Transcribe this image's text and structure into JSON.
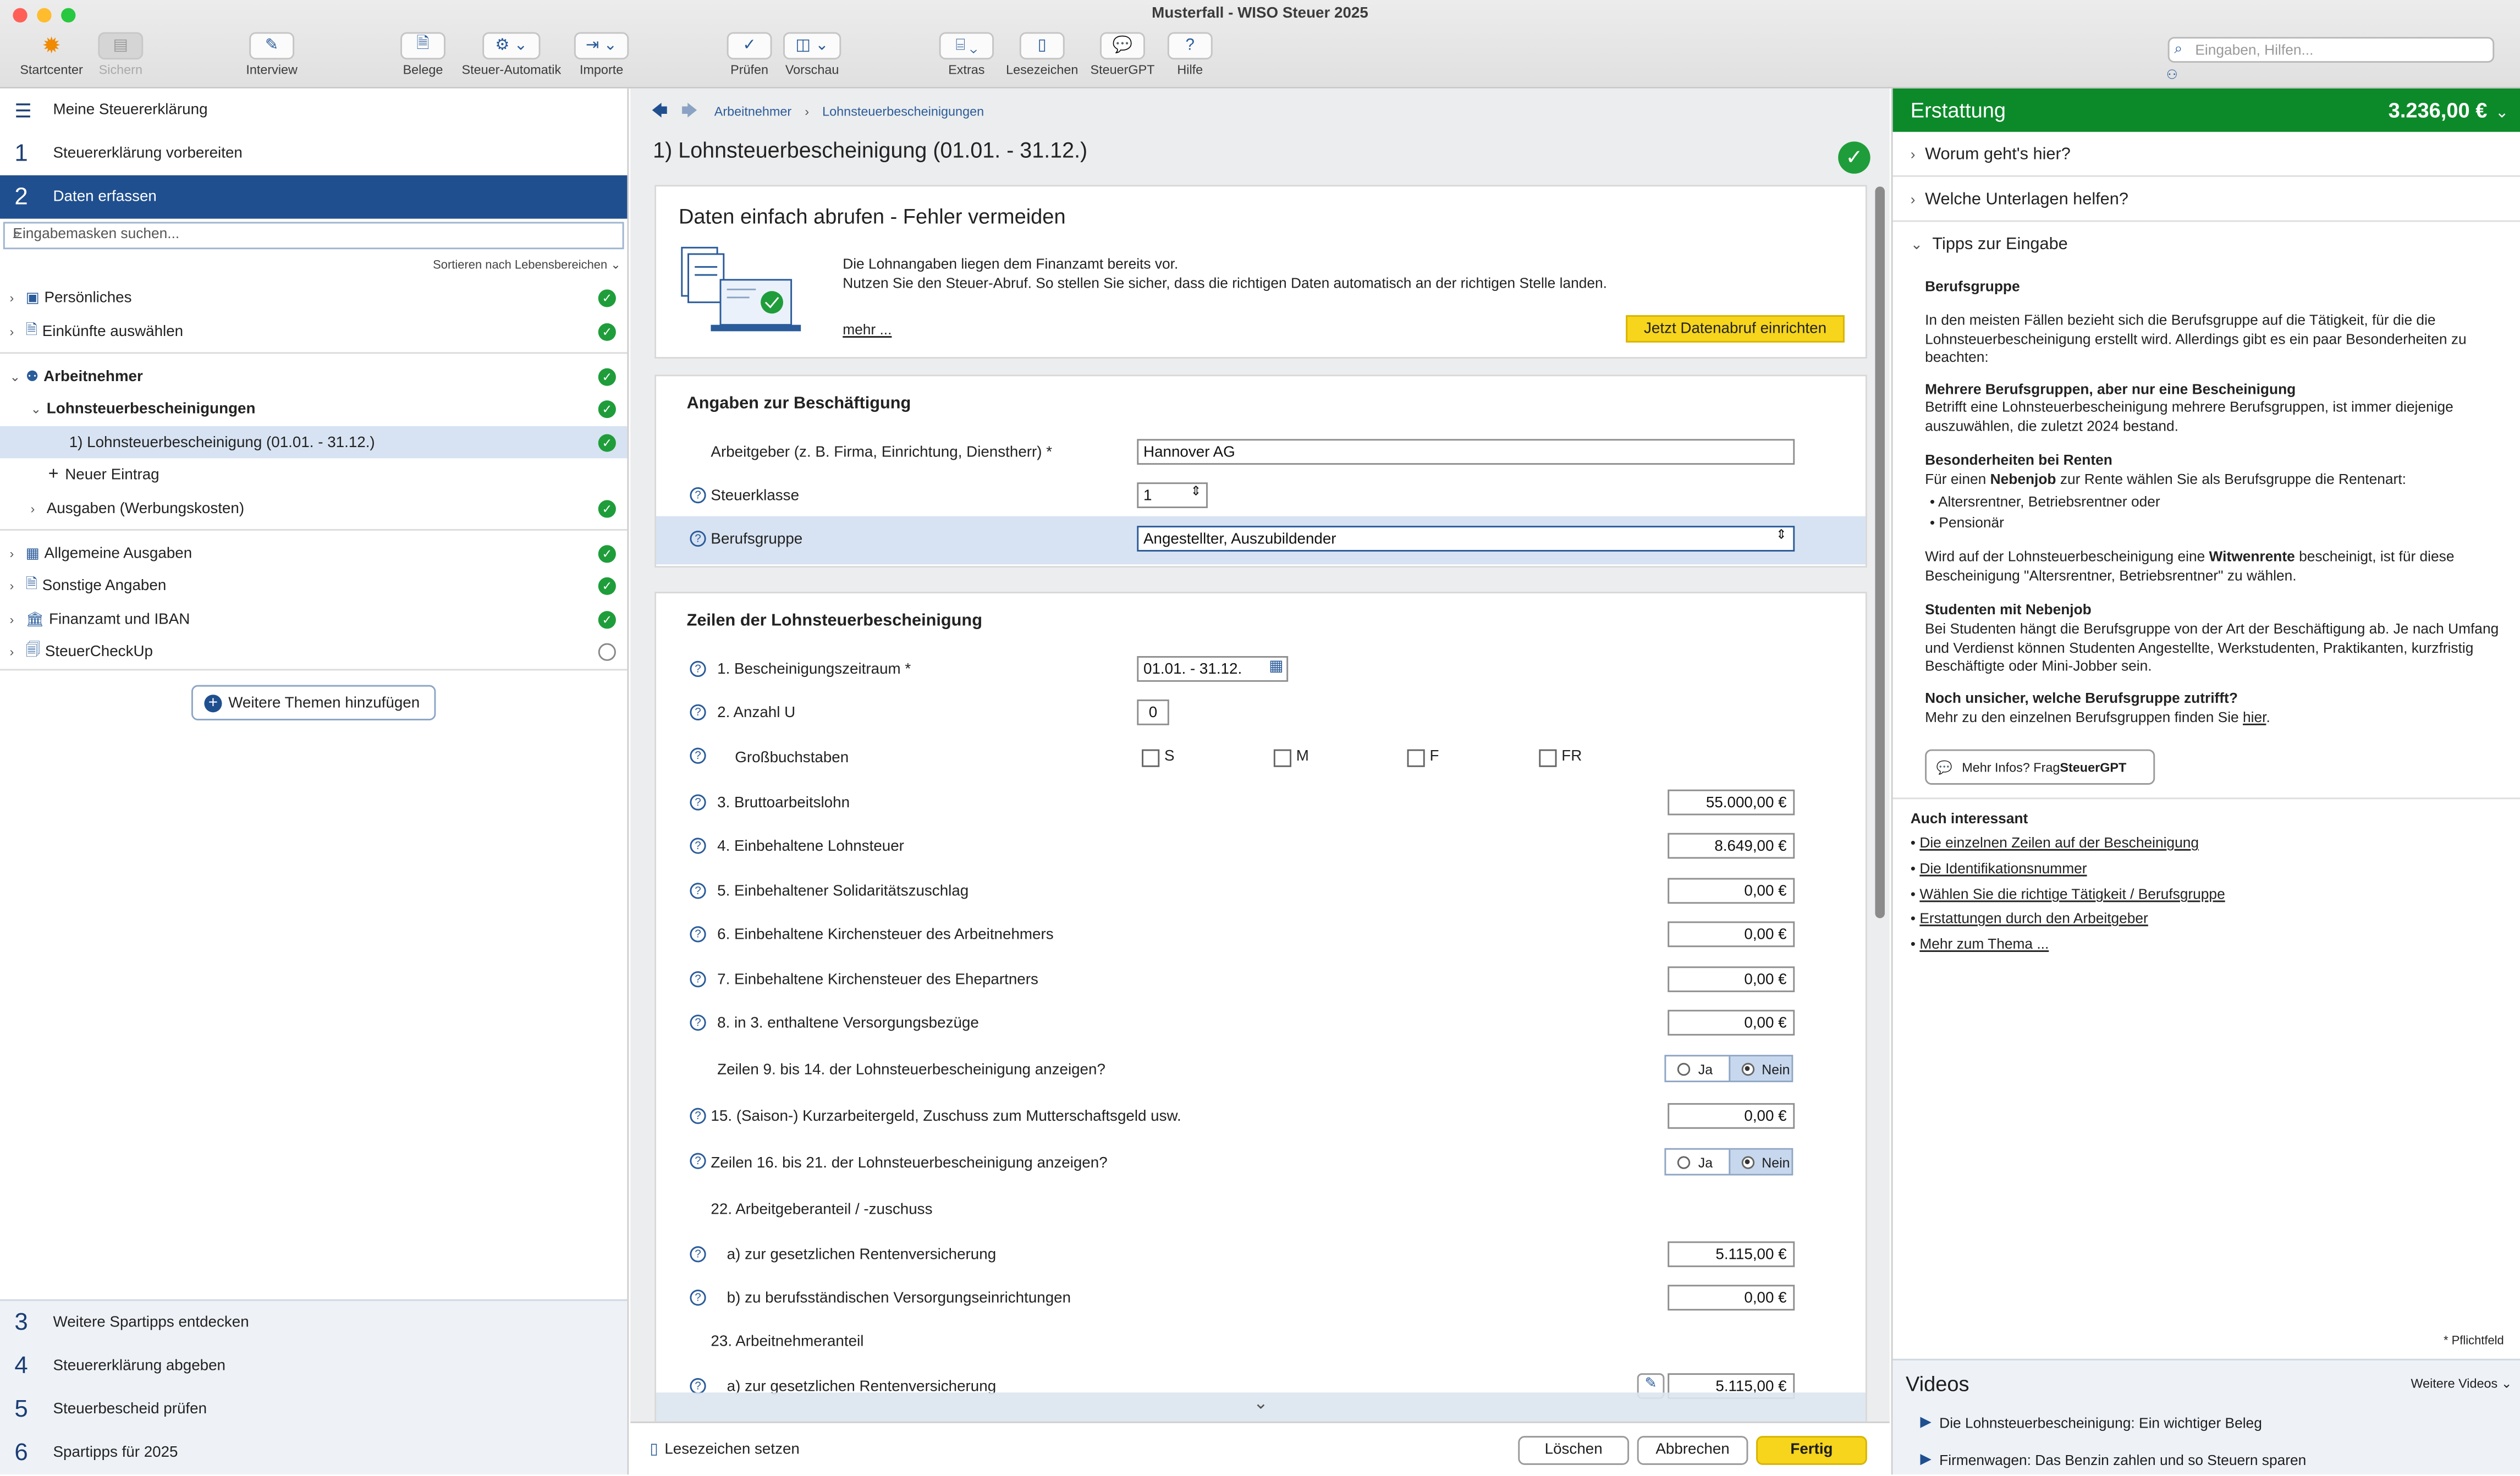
{
  "window": {
    "title": "Musterfall - WISO Steuer 2025"
  },
  "toolbar": {
    "startcenter": "Startcenter",
    "sichern": "Sichern",
    "interview": "Interview",
    "belege": "Belege",
    "steuer_automatik": "Steuer-Automatik",
    "importe": "Importe",
    "pruefen": "Prüfen",
    "vorschau": "Vorschau",
    "extras": "Extras",
    "lesezeichen": "Lesezeichen",
    "steuergpt": "SteuerGPT",
    "hilfe": "Hilfe",
    "search_placeholder": "Eingaben, Hilfen..."
  },
  "sidebar": {
    "header": "Meine Steuererklärung",
    "steps": [
      {
        "n": "1",
        "label": "Steuererklärung vorbereiten"
      },
      {
        "n": "2",
        "label": "Daten erfassen"
      }
    ],
    "search_placeholder": "Eingabemasken suchen...",
    "sort_label": "Sortieren nach Lebensbereichen",
    "tree": {
      "persoenliches": "Persönliches",
      "einkuenfte": "Einkünfte auswählen",
      "arbeitnehmer": "Arbeitnehmer",
      "lohnsteuerbescheinigungen": "Lohnsteuerbescheinigungen",
      "lstb1": "1) Lohnsteuerbescheinigung (01.01. - 31.12.)",
      "neuer_eintrag": "Neuer Eintrag",
      "ausgaben": "Ausgaben (Werbungskosten)",
      "allgemeine": "Allgemeine Ausgaben",
      "sonstige": "Sonstige Angaben",
      "finanzamt": "Finanzamt und IBAN",
      "steuercheckup": "SteuerCheckUp"
    },
    "more_topics": "Weitere Themen hinzufügen",
    "bottom_steps": [
      {
        "n": "3",
        "label": "Weitere Spartipps entdecken"
      },
      {
        "n": "4",
        "label": "Steuererklärung abgeben"
      },
      {
        "n": "5",
        "label": "Steuerbescheid prüfen"
      },
      {
        "n": "6",
        "label": "Spartipps für 2025"
      }
    ]
  },
  "main": {
    "breadcrumb": [
      "Arbeitnehmer",
      "Lohnsteuerbescheinigungen"
    ],
    "title": "1) Lohnsteuerbescheinigung (01.01. - 31.12.)",
    "promo": {
      "heading": "Daten einfach abrufen - Fehler vermeiden",
      "line1": "Die Lohnangaben liegen dem Finanzamt bereits vor.",
      "line2": "Nutzen Sie den Steuer-Abruf. So stellen Sie sicher, dass die richtigen Daten automatisch an der richtigen Stelle landen.",
      "more": "mehr ...",
      "button": "Jetzt Datenabruf einrichten"
    },
    "employment": {
      "heading": "Angaben zur Beschäftigung",
      "employer_label": "Arbeitgeber (z. B. Firma, Einrichtung, Dienstherr) *",
      "employer_value": "Hannover AG",
      "taxclass_label": "Steuerklasse",
      "taxclass_value": "1",
      "group_label": "Berufsgruppe",
      "group_value": "Angestellter, Auszubildender"
    },
    "lines": {
      "heading": "Zeilen der Lohnsteuerbescheinigung",
      "l1": "1. Bescheinigungszeitraum *",
      "l1_value": "01.01. - 31.12.",
      "l2": "2. Anzahl U",
      "l2_value": "0",
      "gross": "Großbuchstaben",
      "opt_s": "S",
      "opt_m": "M",
      "opt_f": "F",
      "opt_fr": "FR",
      "l3": "3. Bruttoarbeitslohn",
      "l3_value": "55.000,00 €",
      "l4": "4. Einbehaltene Lohnsteuer",
      "l4_value": "8.649,00 €",
      "l5": "5. Einbehaltener Solidaritätszuschlag",
      "l5_value": "0,00 €",
      "l6": "6. Einbehaltene Kirchensteuer des Arbeitnehmers",
      "l6_value": "0,00 €",
      "l7": "7. Einbehaltene Kirchensteuer des Ehepartners",
      "l7_value": "0,00 €",
      "l8": "8. in 3. enthaltene Versorgungsbezüge",
      "l8_value": "0,00 €",
      "show9": "Zeilen 9. bis 14. der Lohnsteuerbescheinigung anzeigen?",
      "ja": "Ja",
      "nein": "Nein",
      "l15": "15. (Saison-) Kurzarbeitergeld, Zuschuss zum Mutterschaftsgeld usw.",
      "l15_value": "0,00 €",
      "show16": "Zeilen 16. bis 21. der Lohnsteuerbescheinigung anzeigen?",
      "l22": "22. Arbeitgeberanteil / -zuschuss",
      "l22a": "a) zur gesetzlichen Rentenversicherung",
      "l22a_value": "5.115,00 €",
      "l22b": "b) zu berufsständischen Versorgungseinrichtungen",
      "l22b_value": "0,00 €",
      "l23": "23. Arbeitnehmeranteil",
      "l23a": "a) zur gesetzlichen Rentenversicherung",
      "l23a_value": "5.115,00 €"
    },
    "footer": {
      "bookmark": "Lesezeichen setzen",
      "delete": "Löschen",
      "cancel": "Abbrechen",
      "done": "Fertig"
    }
  },
  "panel": {
    "refund_label": "Erstattung",
    "refund_value": "3.236,00 €",
    "acc1": "Worum geht's hier?",
    "acc2": "Welche Unterlagen helfen?",
    "acc3": "Tipps zur Eingabe",
    "tip_title": "Berufsgruppe",
    "tip_p1": "In den meisten Fällen bezieht sich die Berufsgruppe auf die Tätigkeit, für die die Lohnsteuerbescheinigung erstellt wird. Allerdings gibt es ein paar Besonderheiten zu beachten:",
    "tip_h2": "Mehrere Berufsgruppen, aber nur eine Bescheinigung",
    "tip_p2": "Betrifft eine Lohnsteuerbescheinigung mehrere Berufsgruppen, ist immer diejenige auszuwählen, die zuletzt 2024 bestand.",
    "tip_h3": "Besonderheiten bei Renten",
    "tip_p3a": "Für einen ",
    "tip_p3b": "Nebenjob",
    "tip_p3c": " zur Rente wählen Sie als Berufsgruppe die Rentenart:",
    "tip_b1": "Altersrentner, Betriebsrentner oder",
    "tip_b2": "Pensionär",
    "tip_p4a": "Wird auf der Lohnsteuerbescheinigung eine ",
    "tip_p4b": "Witwenrente",
    "tip_p4c": " bescheinigt, ist für diese Bescheinigung \"Altersrentner, Betriebsrentner\" zu wählen.",
    "tip_h5": "Studenten mit Nebenjob",
    "tip_p5": "Bei Studenten hängt die Berufsgruppe von der Art der Beschäftigung ab. Je nach Umfang und Verdienst können Studenten Angestellte, Werkstudenten, Praktikanten, kurzfristig Beschäftigte oder Mini-Jobber sein.",
    "tip_h6": "Noch unsicher, welche Berufsgruppe zutrifft?",
    "tip_p6": "Mehr zu den einzelnen Berufsgruppen finden Sie ",
    "tip_p6_link": "hier",
    "gpt_button_a": "Mehr Infos? Frag ",
    "gpt_button_b": "SteuerGPT",
    "also_title": "Auch interessant",
    "also": [
      "Die einzelnen Zeilen auf der Bescheinigung",
      "Die Identifikationsnummer",
      "Wählen Sie die richtige Tätigkeit / Berufsgruppe",
      "Erstattungen durch den Arbeitgeber",
      "Mehr zum Thema ..."
    ],
    "mandatory": "* Pflichtfeld",
    "videos_title": "Videos",
    "videos_more": "Weitere Videos",
    "videos": [
      "Die Lohnsteuerbescheinigung: Ein wichtiger Beleg",
      "Firmenwagen: Das Benzin zahlen und so Steuern sparen"
    ]
  }
}
